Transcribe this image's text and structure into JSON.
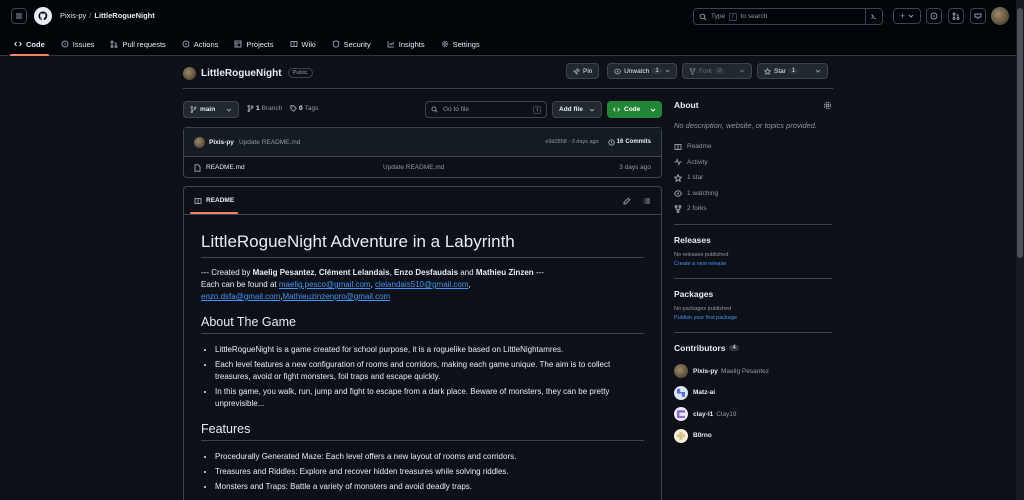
{
  "header": {
    "owner": "Pixis-py",
    "separator": "/",
    "repo": "LittleRogueNight",
    "search_prefix": "Type",
    "search_key": "/",
    "search_suffix": "to search",
    "plus_label": "+"
  },
  "tabs": [
    {
      "label": "Code",
      "icon": "code-icon"
    },
    {
      "label": "Issues",
      "icon": "issue-icon"
    },
    {
      "label": "Pull requests",
      "icon": "pull-request-icon"
    },
    {
      "label": "Actions",
      "icon": "play-icon"
    },
    {
      "label": "Projects",
      "icon": "table-icon"
    },
    {
      "label": "Wiki",
      "icon": "book-icon"
    },
    {
      "label": "Security",
      "icon": "shield-icon"
    },
    {
      "label": "Insights",
      "icon": "graph-icon"
    },
    {
      "label": "Settings",
      "icon": "gear-icon"
    }
  ],
  "repo_header": {
    "name": "LittleRogueNight",
    "visibility": "Public",
    "pin": "Pin",
    "unwatch": "Unwatch",
    "unwatch_count": "1",
    "fork": "Fork",
    "fork_count": "2",
    "star": "Star",
    "star_count": "1"
  },
  "toolbar": {
    "branch": "main",
    "branches_count": "1",
    "branches_label": "Branch",
    "tags_count": "0",
    "tags_label": "Tags",
    "go_to_file": "Go to file",
    "go_to_file_key": "t",
    "add_file": "Add file",
    "code": "Code"
  },
  "commit": {
    "author": "Pixis-py",
    "message": "Update README.md",
    "hash_time": "e9d2858 · 3 days ago",
    "commits_count": "16",
    "commits_label": "Commits"
  },
  "files": [
    {
      "name": "README.md",
      "message": "Update README.md",
      "time": "3 days ago"
    }
  ],
  "readme": {
    "tab_label": "README",
    "title": "LittleRogueNight Adventure in a Labyrinth",
    "credit_prefix": "--- Created by",
    "author1": "Maelig Pesantez",
    "comma1": ",",
    "author2": "Clément Lelandais",
    "comma2": ",",
    "author3": "Enzo Desfaudais",
    "and_word": "and",
    "author4": "Mathieu Zinzen",
    "credit_suffix": "---",
    "found_at": "Each can be found at",
    "email1": "maelig.pesco@gmail.com",
    "sep1": ",",
    "email2": "clelandais510@gmail.com",
    "sep2": ",",
    "email3": "enzo.dsfa@gmail.com",
    "sep3": ",",
    "email4": "Mathieuzinzenpro@gmail.com",
    "about_heading": "About The Game",
    "about_items": [
      "LittleRogueNight is a game created for school purpose, it is a roguelike based on LittleNightamres.",
      "Each level features a new configuration of rooms and corridors, making each game unique. The aim is to collect treasures, avoid or fight monsters, foil traps and escape quickly.",
      "In this game, you walk, run, jump and fight to escape from a dark place. Beware of monsters, they can be pretty unprevisible..."
    ],
    "features_heading": "Features",
    "features_items": [
      "Procedurally Generated Maze: Each level offers a new layout of rooms and corridors.",
      "Treasures and Riddles: Explore and recover hidden treasures while solving riddles.",
      "Monsters and Traps: Battle a variety of monsters and avoid deadly traps."
    ]
  },
  "about": {
    "title": "About",
    "description": "No description, website, or topics provided.",
    "links": [
      {
        "label": "Readme",
        "icon": "book-icon"
      },
      {
        "label": "Activity",
        "icon": "pulse-icon"
      },
      {
        "label": "1 star",
        "icon": "star-icon"
      },
      {
        "label": "1 watching",
        "icon": "eye-icon"
      },
      {
        "label": "2 forks",
        "icon": "fork-icon"
      }
    ]
  },
  "releases": {
    "title": "Releases",
    "empty": "No releases published",
    "create": "Create a new release"
  },
  "packages": {
    "title": "Packages",
    "empty": "No packages published",
    "publish": "Publish your first package"
  },
  "contributors": {
    "title": "Contributors",
    "count": "4",
    "items": [
      {
        "login": "Pixis-py",
        "name": "Maelig Pesantez",
        "color": "#6b5a3e"
      },
      {
        "login": "Matz-ai",
        "name": "",
        "color": "#5a6fd6"
      },
      {
        "login": "clay-l1",
        "name": "Clay19",
        "color": "#8b6fc9"
      },
      {
        "login": "B0rno",
        "name": "",
        "color": "#d8c48f"
      }
    ]
  },
  "colors": {
    "accent": "#238636",
    "link": "#4493f8",
    "tab_underline": "#f78166"
  }
}
